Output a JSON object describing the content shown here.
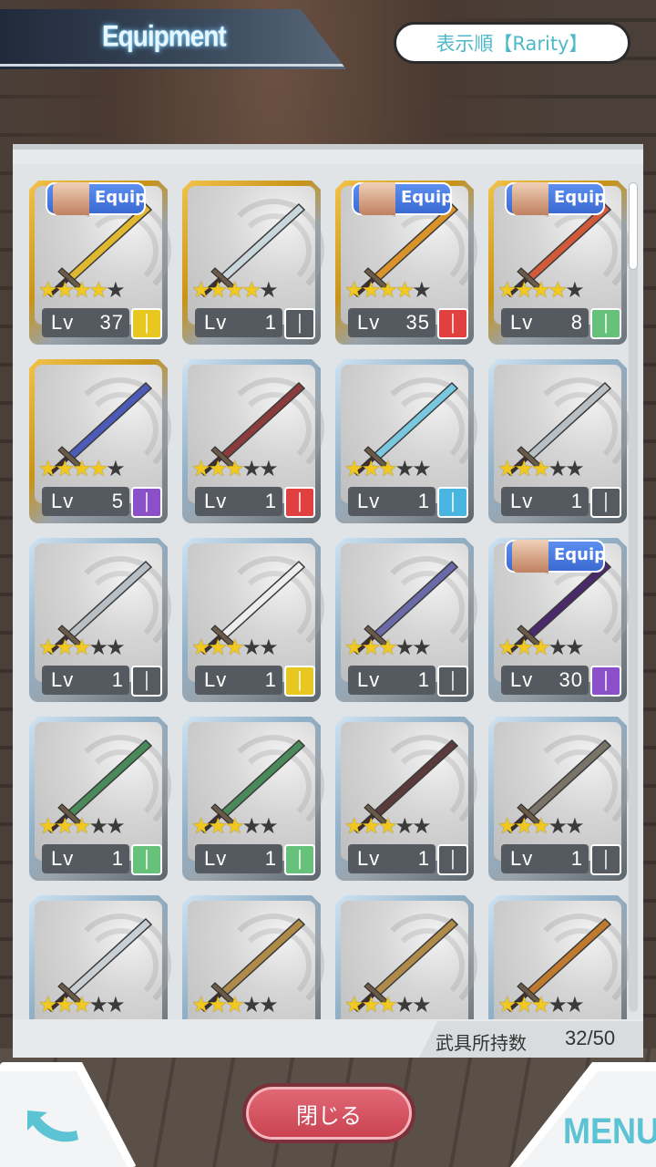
{
  "header": {
    "title": "Equipment",
    "sort_label": "表示順【Rarity】"
  },
  "grid": {
    "equip_label": "Equip",
    "cards": [
      {
        "rarity": "gold",
        "stars": 4,
        "level": "37",
        "type_color": "#e8c820",
        "equipped": true,
        "weapon_color": "#e0b830"
      },
      {
        "rarity": "gold",
        "stars": 4,
        "level": "1",
        "type_color": "#555b61",
        "equipped": false,
        "weapon_color": "#c9d6dc"
      },
      {
        "rarity": "gold",
        "stars": 4,
        "level": "35",
        "type_color": "#e04040",
        "equipped": true,
        "weapon_color": "#d9932a"
      },
      {
        "rarity": "gold",
        "stars": 4,
        "level": "8",
        "type_color": "#66c27a",
        "equipped": true,
        "weapon_color": "#d05a3a"
      },
      {
        "rarity": "gold",
        "stars": 4,
        "level": "5",
        "type_color": "#8a50c8",
        "equipped": false,
        "weapon_color": "#4c5bb8"
      },
      {
        "rarity": "silver",
        "stars": 3,
        "level": "1",
        "type_color": "#e04040",
        "equipped": false,
        "weapon_color": "#8a3b3b"
      },
      {
        "rarity": "silver",
        "stars": 3,
        "level": "1",
        "type_color": "#48b6e0",
        "equipped": false,
        "weapon_color": "#7ac8e0"
      },
      {
        "rarity": "silver",
        "stars": 3,
        "level": "1",
        "type_color": "#555b61",
        "equipped": false,
        "weapon_color": "#b8c0c6"
      },
      {
        "rarity": "silver",
        "stars": 3,
        "level": "1",
        "type_color": "#555b61",
        "equipped": false,
        "weapon_color": "#b8c0c6"
      },
      {
        "rarity": "silver",
        "stars": 3,
        "level": "1",
        "type_color": "#e8c820",
        "equipped": false,
        "weapon_color": "#eeeeee"
      },
      {
        "rarity": "silver",
        "stars": 3,
        "level": "1",
        "type_color": "#555b61",
        "equipped": false,
        "weapon_color": "#6a6aa8"
      },
      {
        "rarity": "silver",
        "stars": 3,
        "level": "30",
        "type_color": "#8a50c8",
        "equipped": true,
        "weapon_color": "#4a2a6a"
      },
      {
        "rarity": "silver",
        "stars": 3,
        "level": "1",
        "type_color": "#66c27a",
        "equipped": false,
        "weapon_color": "#4a8a5a"
      },
      {
        "rarity": "silver",
        "stars": 3,
        "level": "1",
        "type_color": "#66c27a",
        "equipped": false,
        "weapon_color": "#4a8a5a"
      },
      {
        "rarity": "silver",
        "stars": 3,
        "level": "1",
        "type_color": "#555b61",
        "equipped": false,
        "weapon_color": "#5a3a3a"
      },
      {
        "rarity": "silver",
        "stars": 3,
        "level": "1",
        "type_color": "#555b61",
        "equipped": false,
        "weapon_color": "#7a7468"
      },
      {
        "rarity": "silver",
        "stars": 3,
        "level": "",
        "type_color": "",
        "equipped": false,
        "weapon_color": "#c8d0d6"
      },
      {
        "rarity": "silver",
        "stars": 3,
        "level": "",
        "type_color": "",
        "equipped": false,
        "weapon_color": "#b08a48"
      },
      {
        "rarity": "silver",
        "stars": 3,
        "level": "",
        "type_color": "",
        "equipped": false,
        "weapon_color": "#b08a48"
      },
      {
        "rarity": "silver",
        "stars": 3,
        "level": "",
        "type_color": "",
        "equipped": false,
        "weapon_color": "#c07a30"
      }
    ]
  },
  "footer": {
    "count_label": "武具所持数",
    "count_value": "32/50",
    "close_label": "閉じる",
    "menu_label": "MENU",
    "back_icon": "back-arrow-icon"
  }
}
